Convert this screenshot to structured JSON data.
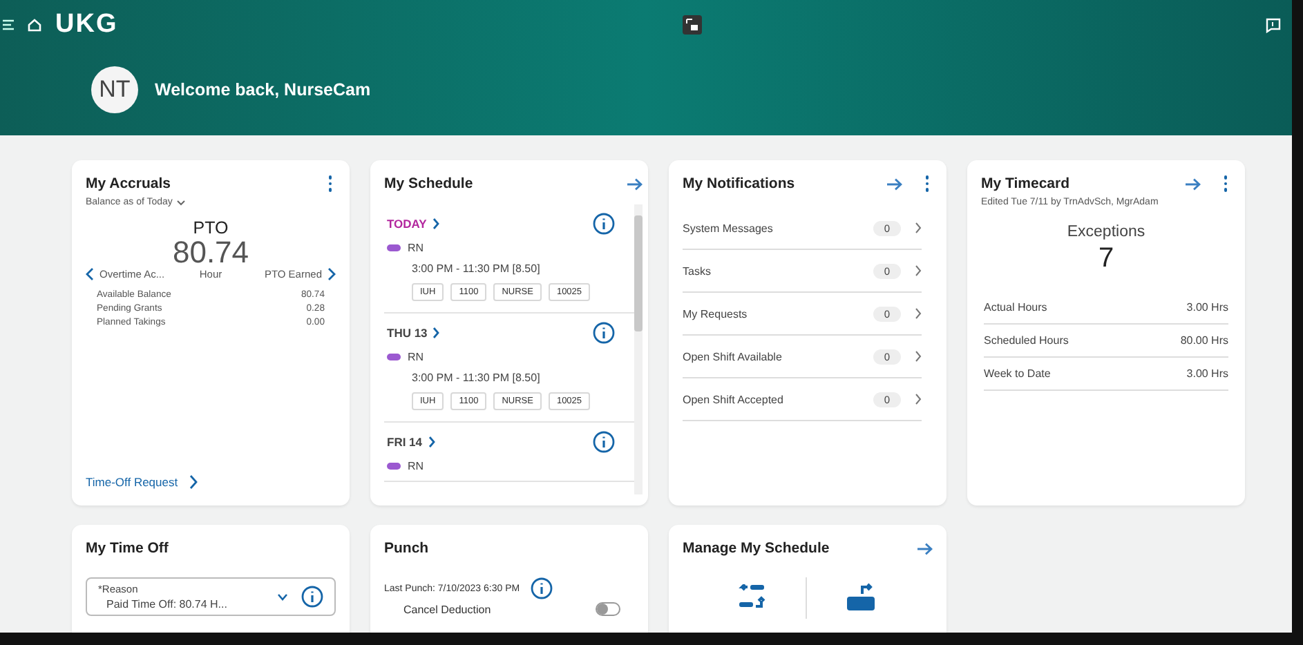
{
  "header": {
    "logo": "UKG",
    "avatar_initials": "NT",
    "welcome": "Welcome back, NurseCam"
  },
  "accruals": {
    "title": "My Accruals",
    "subtitle": "Balance as of Today",
    "code": "PTO",
    "amount": "80.74",
    "unit": "Hour",
    "prev": "Overtime Ac...",
    "next": "PTO Earned",
    "rows": [
      {
        "label": "Available Balance",
        "value": "80.74"
      },
      {
        "label": "Pending Grants",
        "value": "0.28"
      },
      {
        "label": "Planned Takings",
        "value": "0.00"
      }
    ],
    "link": "Time-Off Request"
  },
  "schedule": {
    "title": "My Schedule",
    "days": [
      {
        "day": "TODAY",
        "today": true,
        "job": "RN",
        "time": "3:00 PM - 11:30 PM [8.50]",
        "tags": [
          "IUH",
          "1100",
          "NURSE",
          "10025"
        ]
      },
      {
        "day": "THU 13",
        "today": false,
        "job": "RN",
        "time": "3:00 PM - 11:30 PM [8.50]",
        "tags": [
          "IUH",
          "1100",
          "NURSE",
          "10025"
        ]
      },
      {
        "day": "FRI 14",
        "today": false,
        "job": "RN"
      }
    ]
  },
  "notifications": {
    "title": "My Notifications",
    "items": [
      {
        "label": "System Messages",
        "count": "0"
      },
      {
        "label": "Tasks",
        "count": "0"
      },
      {
        "label": "My Requests",
        "count": "0"
      },
      {
        "label": "Open Shift Available",
        "count": "0"
      },
      {
        "label": "Open Shift Accepted",
        "count": "0"
      }
    ]
  },
  "timecard": {
    "title": "My Timecard",
    "edited": "Edited Tue 7/11 by TrnAdvSch, MgrAdam",
    "exceptions_label": "Exceptions",
    "exceptions": "7",
    "rows": [
      {
        "label": "Actual Hours",
        "value": "3.00 Hrs"
      },
      {
        "label": "Scheduled Hours",
        "value": "80.00 Hrs"
      },
      {
        "label": "Week to Date",
        "value": "3.00 Hrs"
      }
    ]
  },
  "time_off": {
    "title": "My Time Off",
    "reason_label": "*Reason",
    "reason_value": "Paid Time Off: 80.74 H..."
  },
  "punch": {
    "title": "Punch",
    "last_punch": "Last Punch: 7/10/2023 6:30 PM",
    "toggle_label": "Cancel Deduction",
    "on": false
  },
  "manage": {
    "title": "Manage My Schedule"
  }
}
